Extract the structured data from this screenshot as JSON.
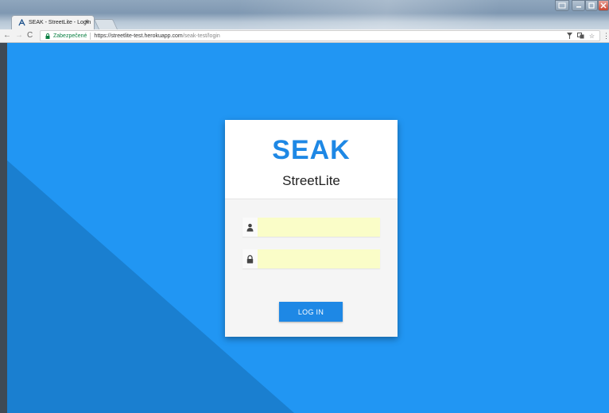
{
  "browser": {
    "tab_title": "SEAK - StreetLite - Login",
    "tab_close": "×",
    "nav_back": "←",
    "nav_forward": "→",
    "nav_reload": "C",
    "secure_label": "Zabezpečené",
    "url_host": "https://streetlite-test.herokuapp.com",
    "url_path": "/seak-test/login",
    "bookmark_star": "☆",
    "menu": "⋮"
  },
  "login": {
    "logo_text": "SEAK",
    "app_name": "StreetLite",
    "username": {
      "value": "",
      "placeholder": ""
    },
    "password": {
      "value": "",
      "placeholder": ""
    },
    "submit_label": "LOG IN"
  },
  "colors": {
    "page_background": "#2196f3",
    "page_diagonal": "#1a7fd0",
    "brand_blue": "#1e88e5",
    "autofill_yellow": "#fafdc8"
  }
}
